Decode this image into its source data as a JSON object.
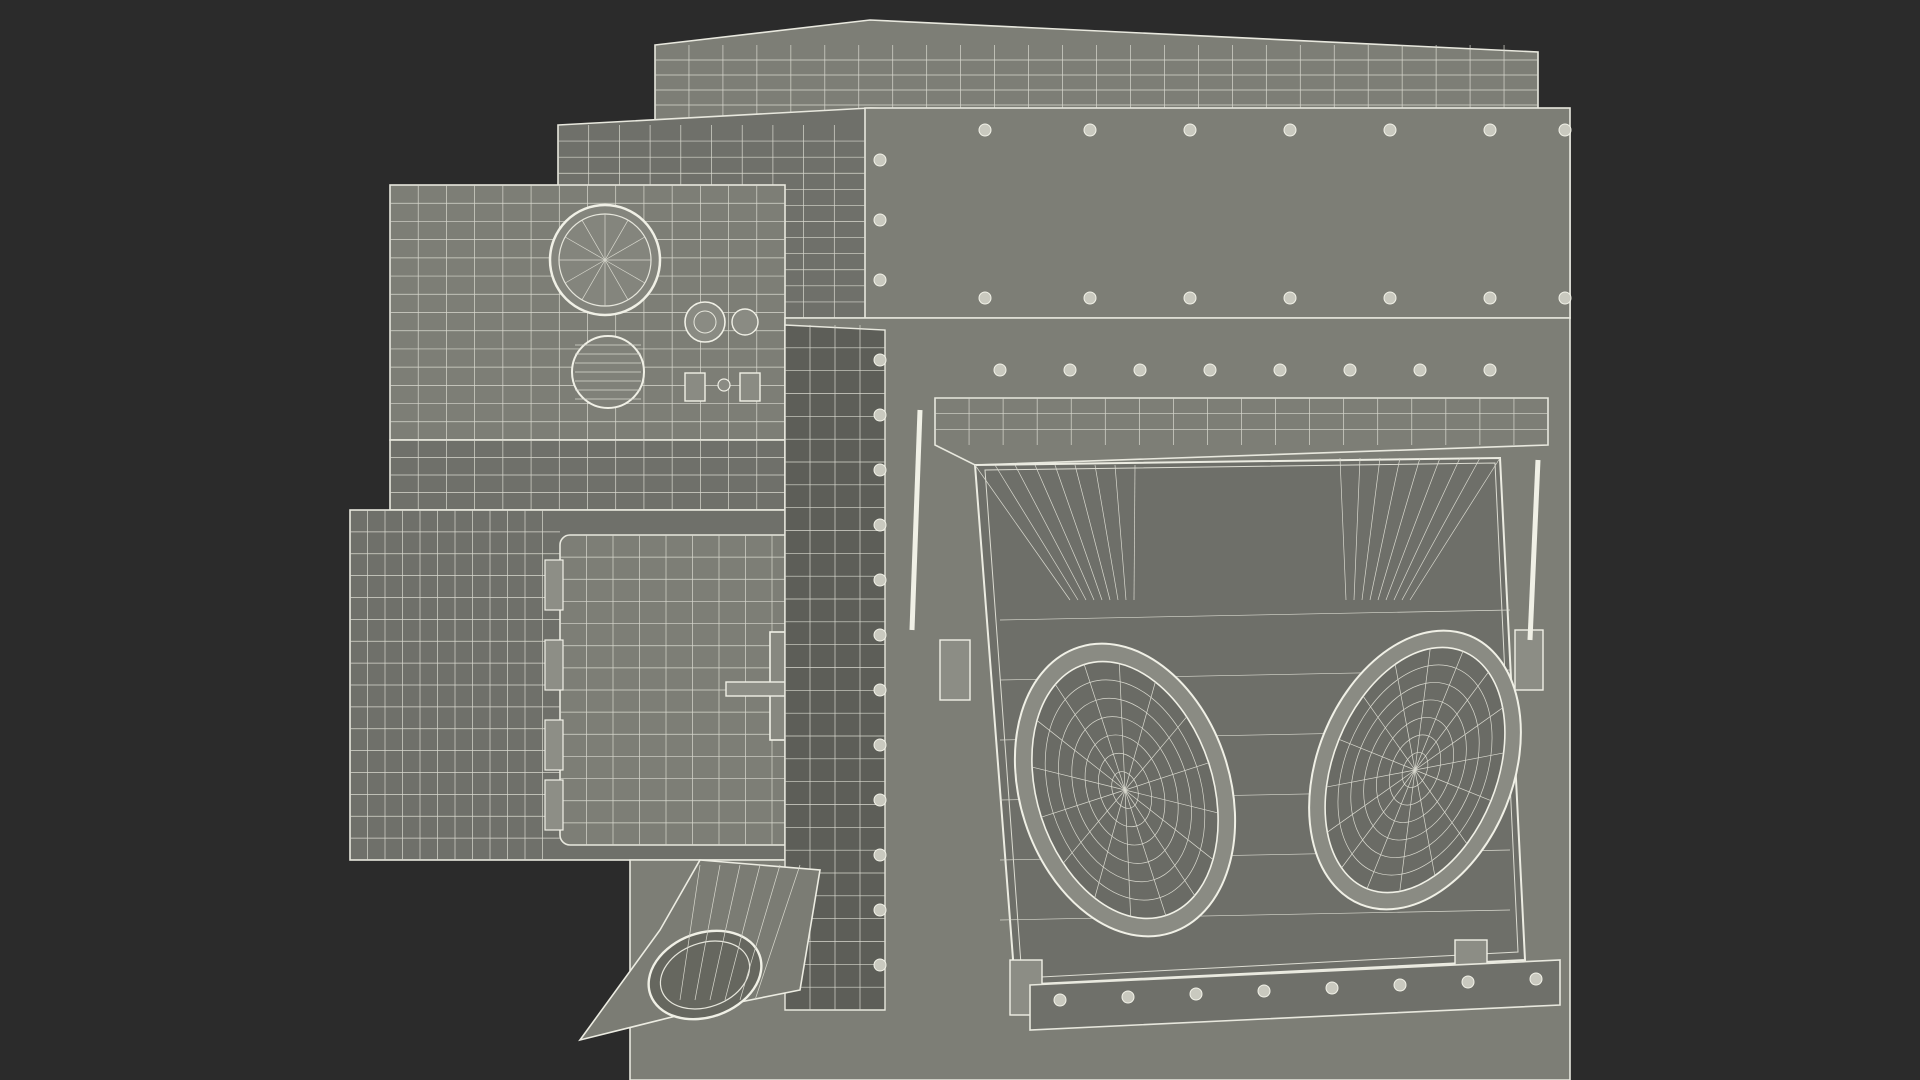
{
  "scene": {
    "background_color": "#2b2b2b",
    "model_fill_color": "#7d7e76",
    "wireframe_color": "#e6e6dc",
    "subject": "glovebox-wireframe-model"
  }
}
